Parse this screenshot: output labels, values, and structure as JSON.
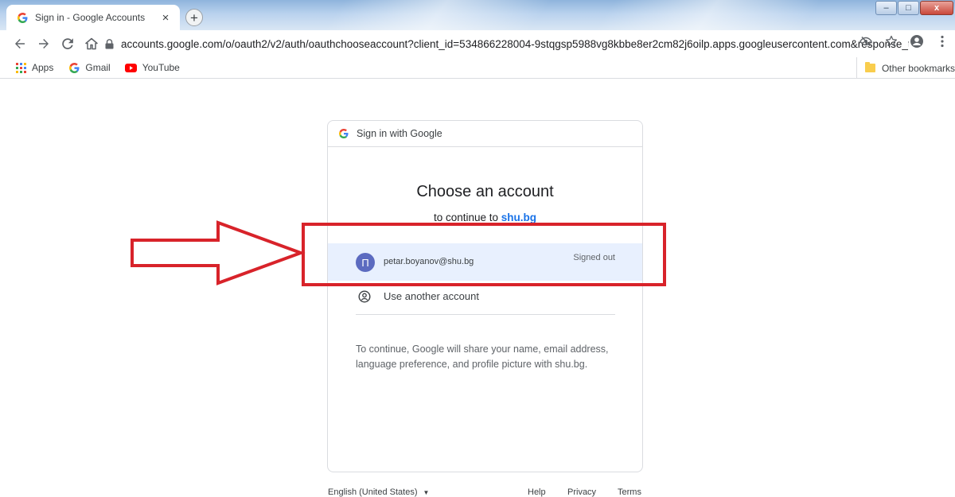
{
  "browser": {
    "tab_title": "Sign in - Google Accounts",
    "tab_close": "×",
    "new_tab": "+",
    "url": "accounts.google.com/o/oauth2/v2/auth/oauthchooseaccount?client_id=534866228004-9stqgsp5988vg8kbbe8er2cm82j6oilp.apps.googleusercontent.com&response_t...",
    "window_controls": [
      "–",
      "□",
      "x"
    ]
  },
  "bookmarks": {
    "items": [
      {
        "label": "Apps",
        "icon": "apps-grid-icon"
      },
      {
        "label": "Gmail",
        "icon": "google-g-icon"
      },
      {
        "label": "YouTube",
        "icon": "youtube-icon"
      }
    ],
    "other": "Other bookmarks"
  },
  "card": {
    "header": "Sign in with Google",
    "headline": "Choose an account",
    "subline_prefix": "to continue to ",
    "subline_domain": "shu.bg",
    "account": {
      "initial": "П",
      "email": "petar.boyanov@shu.bg",
      "status": "Signed out"
    },
    "use_another": "Use another account",
    "disclaimer": "To continue, Google will share your name, email address, language preference, and profile picture with shu.bg."
  },
  "footer": {
    "language": "English (United States)",
    "language_caret": "▼",
    "links": [
      "Help",
      "Privacy",
      "Terms"
    ]
  },
  "colors": {
    "accent": "#1a73e8",
    "selected_row": "#e8f0fe",
    "avatar": "#5c6bc0",
    "annotation": "#d8232a"
  }
}
